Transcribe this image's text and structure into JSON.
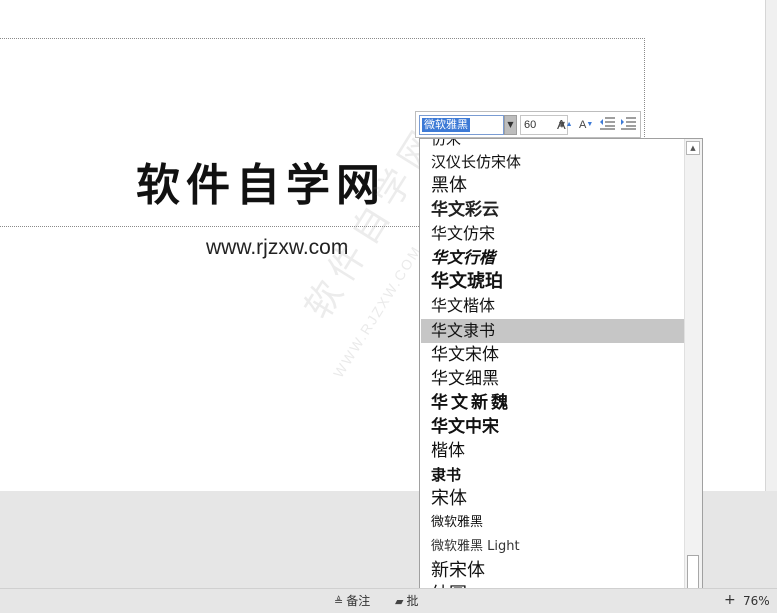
{
  "slide": {
    "title": "软件自学网",
    "subtitle": "www.rjzxw.com",
    "watermark": "软件自学网",
    "watermark_url": "WWW.RJZXW.COM"
  },
  "mini_toolbar": {
    "font_name": "微软雅黑",
    "font_size": "60",
    "grow_font_label": "A",
    "shrink_font_label": "A",
    "dropdown_arrow_icon": "chevron-down-icon",
    "decrease_indent_icon": "decrease-indent-icon",
    "increase_indent_icon": "increase-indent-icon"
  },
  "font_list": {
    "selected_index": 7,
    "items": [
      {
        "label": "仿宋"
      },
      {
        "label": "汉仪长仿宋体"
      },
      {
        "label": "黑体"
      },
      {
        "label": "华文彩云"
      },
      {
        "label": "华文仿宋"
      },
      {
        "label": "华文行楷"
      },
      {
        "label": "华文琥珀"
      },
      {
        "label": "华文楷体"
      },
      {
        "label": "华文隶书"
      },
      {
        "label": "华文宋体"
      },
      {
        "label": "华文细黑"
      },
      {
        "label": "华文新魏"
      },
      {
        "label": "华文中宋"
      },
      {
        "label": "楷体"
      },
      {
        "label": "隶书"
      },
      {
        "label": "宋体"
      },
      {
        "label": "微软雅黑"
      },
      {
        "label": "微软雅黑 Light"
      },
      {
        "label": "新宋体"
      },
      {
        "label": "幼圆"
      }
    ]
  },
  "statusbar": {
    "notes_label": "备注",
    "comments_label": "批",
    "zoom_plus": "+",
    "zoom_level": "76%"
  },
  "colors": {
    "selection_bg": "#c6c6c6",
    "accent": "#3d7ad6"
  }
}
